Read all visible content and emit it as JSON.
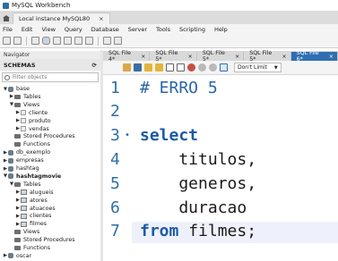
{
  "window": {
    "title": "MySQL Workbench"
  },
  "connection_tab": {
    "label": "Local instance MySQL80",
    "close": "×"
  },
  "menu": [
    "File",
    "Edit",
    "View",
    "Query",
    "Database",
    "Server",
    "Tools",
    "Scripting",
    "Help"
  ],
  "navigator": {
    "header": "Navigator",
    "schemas_label": "SCHEMAS",
    "filter_placeholder": "Filter objects",
    "tree": [
      {
        "label": "base",
        "level": 0,
        "twisty": "▼",
        "icon": "database-icon",
        "bold": false
      },
      {
        "label": "Tables",
        "level": 1,
        "twisty": "▶",
        "icon": "folder-icon",
        "bold": false
      },
      {
        "label": "Views",
        "level": 1,
        "twisty": "▼",
        "icon": "folder-icon",
        "bold": false
      },
      {
        "label": "cliente",
        "level": 2,
        "twisty": "▶",
        "icon": "view-icon",
        "bold": false
      },
      {
        "label": "produto",
        "level": 2,
        "twisty": "▶",
        "icon": "view-icon",
        "bold": false
      },
      {
        "label": "vendas",
        "level": 2,
        "twisty": "▶",
        "icon": "view-icon",
        "bold": false
      },
      {
        "label": "Stored Procedures",
        "level": 1,
        "twisty": "",
        "icon": "folder-icon",
        "bold": false
      },
      {
        "label": "Functions",
        "level": 1,
        "twisty": "",
        "icon": "folder-icon",
        "bold": false
      },
      {
        "label": "db_exemplo",
        "level": 0,
        "twisty": "▶",
        "icon": "database-icon",
        "bold": false
      },
      {
        "label": "empresas",
        "level": 0,
        "twisty": "▶",
        "icon": "database-icon",
        "bold": false
      },
      {
        "label": "hashtag",
        "level": 0,
        "twisty": "▶",
        "icon": "database-icon",
        "bold": false
      },
      {
        "label": "hashtagmovie",
        "level": 0,
        "twisty": "▼",
        "icon": "database-icon",
        "bold": true
      },
      {
        "label": "Tables",
        "level": 1,
        "twisty": "▼",
        "icon": "folder-icon",
        "bold": false
      },
      {
        "label": "alugueis",
        "level": 2,
        "twisty": "▶",
        "icon": "table-icon",
        "bold": false
      },
      {
        "label": "atores",
        "level": 2,
        "twisty": "▶",
        "icon": "table-icon",
        "bold": false
      },
      {
        "label": "atuacoes",
        "level": 2,
        "twisty": "▶",
        "icon": "table-icon",
        "bold": false
      },
      {
        "label": "clientes",
        "level": 2,
        "twisty": "▶",
        "icon": "table-icon",
        "bold": false
      },
      {
        "label": "filmes",
        "level": 2,
        "twisty": "▶",
        "icon": "table-icon",
        "bold": false
      },
      {
        "label": "Views",
        "level": 1,
        "twisty": "",
        "icon": "folder-icon",
        "bold": false
      },
      {
        "label": "Stored Procedures",
        "level": 1,
        "twisty": "",
        "icon": "folder-icon",
        "bold": false
      },
      {
        "label": "Functions",
        "level": 1,
        "twisty": "",
        "icon": "folder-icon",
        "bold": false
      },
      {
        "label": "oscar",
        "level": 0,
        "twisty": "▶",
        "icon": "database-icon",
        "bold": false
      }
    ]
  },
  "sql_tabs": [
    {
      "label": "SQL File 4*",
      "active": false
    },
    {
      "label": "SQL File 5*",
      "active": false
    },
    {
      "label": "SQL File 5*",
      "active": false
    },
    {
      "label": "SQL File 5*",
      "active": false
    },
    {
      "label": "SQL File 6*",
      "active": true
    }
  ],
  "limit_select": {
    "value": "Don't Limit"
  },
  "editor": {
    "lines": [
      {
        "n": "1",
        "fold": "",
        "tokens": [
          {
            "t": "# ERRO 5",
            "c": "cmt"
          }
        ]
      },
      {
        "n": "2",
        "fold": "",
        "tokens": []
      },
      {
        "n": "3",
        "fold": "•",
        "tokens": [
          {
            "t": "select",
            "c": "kw"
          }
        ]
      },
      {
        "n": "4",
        "fold": "",
        "tokens": [
          {
            "t": "    titulos,",
            "c": ""
          }
        ]
      },
      {
        "n": "5",
        "fold": "",
        "tokens": [
          {
            "t": "    generos,",
            "c": ""
          }
        ]
      },
      {
        "n": "6",
        "fold": "",
        "tokens": [
          {
            "t": "    duracao",
            "c": ""
          }
        ]
      },
      {
        "n": "7",
        "fold": "",
        "tokens": [
          {
            "t": "from",
            "c": "kw"
          },
          {
            "t": " filmes;",
            "c": ""
          }
        ]
      }
    ]
  }
}
